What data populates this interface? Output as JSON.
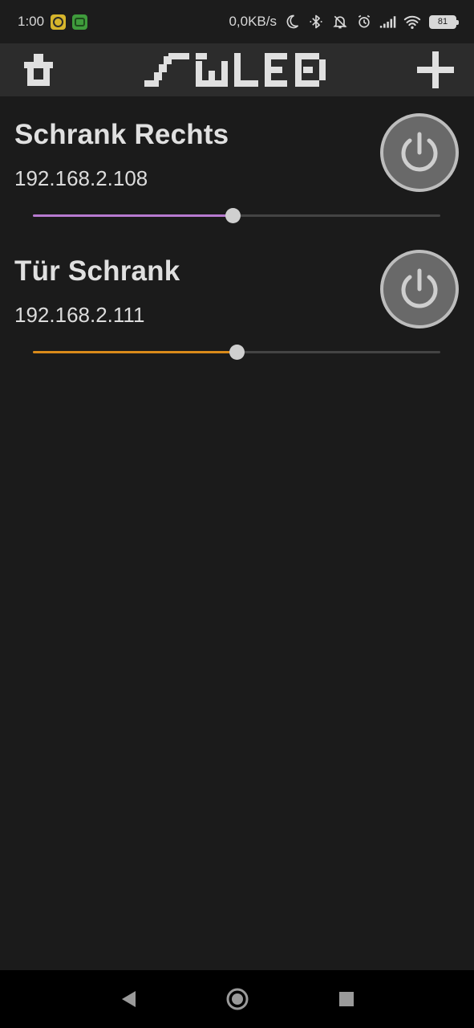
{
  "status_bar": {
    "time": "1:00",
    "net_speed": "0,0KB/s",
    "battery_level": "81"
  },
  "app_bar": {
    "left_icon": "clean-brush-icon",
    "logo_icon": "swled-logo",
    "right_icon": "plus-icon"
  },
  "devices": [
    {
      "name": "Schrank Rechts",
      "ip": "192.168.2.108",
      "brightness": 0.49,
      "color": "#b77ad0"
    },
    {
      "name": "Tür Schrank",
      "ip": "192.168.2.111",
      "brightness": 0.5,
      "color": "#d98a1a"
    }
  ],
  "colors": {
    "background": "#1b1b1b",
    "app_bar": "#2c2c2c",
    "power_button": "#696969"
  }
}
